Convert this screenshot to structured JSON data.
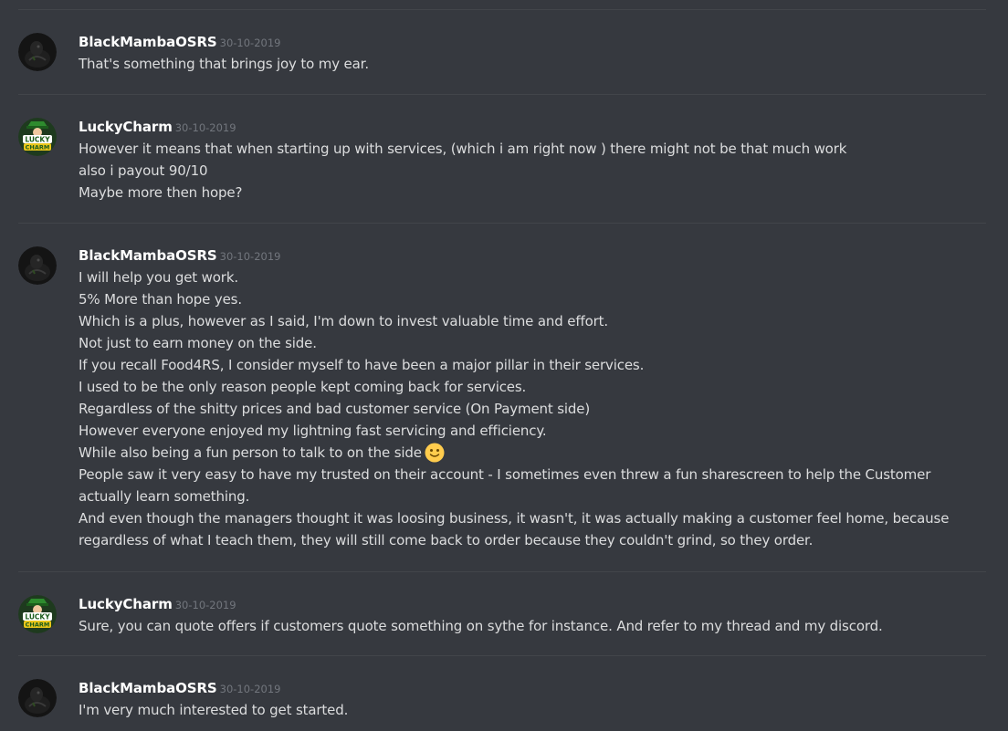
{
  "messages": [
    {
      "author": "BlackMambaOSRS",
      "timestamp": "30-10-2019",
      "avatar": "blackmamba-avatar",
      "lines": [
        "That's something that brings joy to my ear."
      ]
    },
    {
      "author": "LuckyCharm",
      "timestamp": "30-10-2019",
      "avatar": "luckycharm-avatar",
      "lines": [
        "However it means that when starting up with services, (which i am right now ) there might not be that much work",
        "also i payout 90/10",
        "Maybe more then hope?"
      ]
    },
    {
      "author": "BlackMambaOSRS",
      "timestamp": "30-10-2019",
      "avatar": "blackmamba-avatar",
      "lines": [
        "I will help you get work.",
        "5% More than hope yes.",
        "Which is a plus, however as I said, I'm down to invest valuable time and effort.",
        "Not just to earn money on the side.",
        "If you recall Food4RS, I consider myself to have been a major pillar in their services.",
        "I used to be the only reason people kept coming back for services.",
        "Regardless of the shitty prices and bad customer service (On Payment side)",
        "However everyone enjoyed my lightning fast servicing and efficiency.",
        "While also being a fun person to talk to on the side",
        "People saw it very easy to have my trusted on their account - I sometimes even threw a fun sharescreen to help the Customer",
        "actually learn something.",
        "And even though the managers thought it was loosing business, it wasn't, it was actually making a customer feel home, because",
        "regardless of what I teach them, they will still come back to order because they couldn't grind, so they order."
      ]
    },
    {
      "author": "LuckyCharm",
      "timestamp": "30-10-2019",
      "avatar": "luckycharm-avatar",
      "lines": [
        "Sure, you can quote offers if customers quote something on sythe for instance. And refer to my thread and my discord."
      ]
    },
    {
      "author": "BlackMambaOSRS",
      "timestamp": "30-10-2019",
      "avatar": "blackmamba-avatar",
      "lines": [
        "I'm very much interested to get started."
      ]
    }
  ],
  "emoji": {
    "name": "slightly-smiling-face-icon",
    "message_index": 2,
    "line_index": 8
  },
  "colors": {
    "background": "#36393f",
    "username": "#ffffff",
    "timestamp": "#72767d",
    "text": "#dcddde",
    "divider": "#42454a",
    "lucky_green": "#2e8b2e",
    "lucky_yellow": "#e8c51a"
  }
}
